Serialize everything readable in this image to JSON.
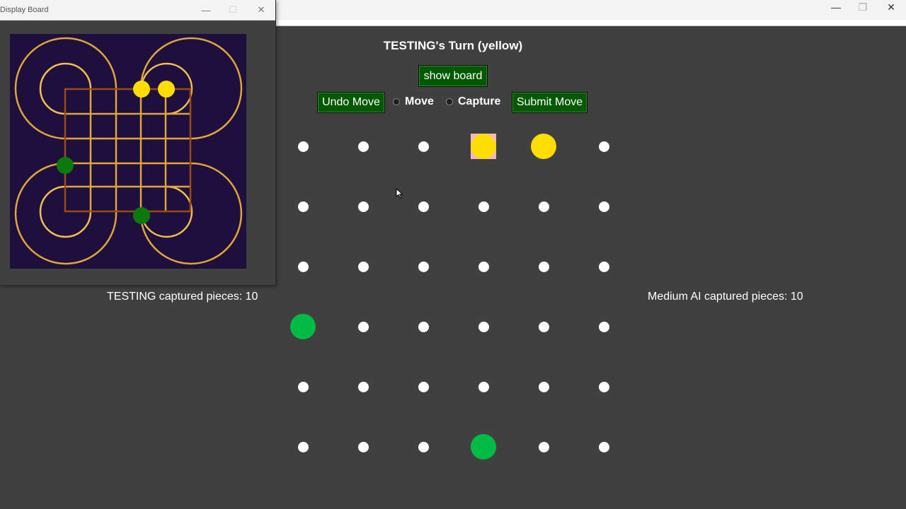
{
  "main_window": {
    "controls": {
      "minimize": "—",
      "maximize": "❐",
      "close": "✕"
    }
  },
  "display_window": {
    "title": "Display Board",
    "controls": {
      "minimize": "—",
      "maximize": "☐",
      "close": "✕"
    }
  },
  "game": {
    "turn_title": "TESTING's Turn (yellow)",
    "show_board_label": "show board",
    "undo_label": "Undo Move",
    "submit_label": "Submit Move",
    "radio_move_label": "Move",
    "radio_capture_label": "Capture",
    "player_captured": "TESTING captured pieces: 10",
    "ai_captured": "Medium AI captured pieces: 10"
  },
  "board": {
    "rows": 6,
    "cols": 6,
    "pieces": [
      {
        "row": 0,
        "col": 3,
        "color": "yellow",
        "selected": true
      },
      {
        "row": 0,
        "col": 4,
        "color": "yellow",
        "selected": false
      },
      {
        "row": 3,
        "col": 0,
        "color": "green",
        "selected": false
      },
      {
        "row": 5,
        "col": 3,
        "color": "green",
        "selected": false
      }
    ]
  },
  "colors": {
    "background": "#404040",
    "button_green": "#025902",
    "yellow_piece": "#ffdd00",
    "green_piece": "#00bb44",
    "selection_highlight": "#f4b6c2",
    "board_bg": "#1e0f3c",
    "outer_track": "#e0a63a",
    "inner_track": "#9a4a12",
    "display_green_piece": "#0b7a0b"
  }
}
